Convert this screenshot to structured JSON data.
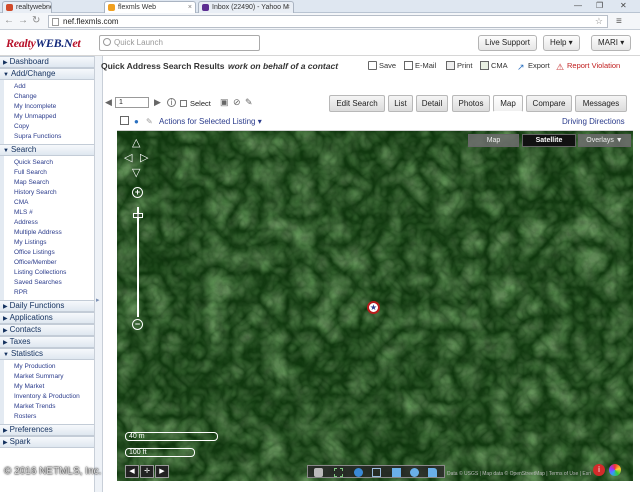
{
  "browser": {
    "tabs": [
      {
        "label": "realtywebnet",
        "color": "#d14a2a",
        "active": false
      },
      {
        "label": "flexmls Web",
        "color": "#f0a020",
        "active": true
      },
      {
        "label": "Inbox (22490) - Yahoo M",
        "color": "#5c2d91",
        "active": false
      }
    ],
    "url": "nef.flexmls.com"
  },
  "header": {
    "logo_a": "Realty",
    "logo_b": "WEB",
    "logo_c": ".N",
    "logo_d": "et",
    "quick_launch_placeholder": "Quick Launch",
    "live_support": "Live Support",
    "help": "Help",
    "user": "MARI"
  },
  "sidebar": {
    "sections": [
      {
        "title": "Dashboard",
        "items": []
      },
      {
        "title": "Add/Change",
        "items": [
          "Add",
          "Change",
          "My Incomplete",
          "My Unmapped",
          "Copy",
          "Supra Functions"
        ]
      },
      {
        "title": "Search",
        "items": [
          "Quick Search",
          "Full Search",
          "Map Search",
          "History Search",
          "CMA",
          "MLS #",
          "Address",
          "Multiple Address",
          "My Listings",
          "Office Listings",
          "Office/Member",
          "Listing Collections",
          "Saved Searches",
          "RPR"
        ]
      },
      {
        "title": "Daily Functions",
        "items": []
      },
      {
        "title": "Applications",
        "items": []
      },
      {
        "title": "Contacts",
        "items": []
      },
      {
        "title": "Taxes",
        "items": []
      },
      {
        "title": "Statistics",
        "items": [
          "My Production",
          "Market Summary",
          "My Market",
          "Inventory & Production",
          "Market Trends",
          "Rosters"
        ]
      },
      {
        "title": "Preferences",
        "items": []
      },
      {
        "title": "Spark",
        "items": []
      }
    ]
  },
  "page": {
    "title": "Quick Address Search Results",
    "subtitle": "work on behalf of a contact",
    "tools": [
      "Save",
      "E-Mail",
      "Print",
      "CMA",
      "Export",
      "Report Violation"
    ],
    "page_number": "1",
    "select_label": "Select",
    "view_tabs": [
      "Edit Search",
      "List",
      "Detail",
      "Photos",
      "Map",
      "Compare",
      "Messages"
    ],
    "active_view": "Map",
    "actions_label": "Actions for Selected Listing",
    "directions_label": "Driving Directions"
  },
  "map": {
    "types": [
      "Map",
      "Satellite",
      "Overlays ▼"
    ],
    "active_type": "Satellite",
    "zoom_level_fraction": 0.06,
    "scale_metric": "40 m",
    "scale_imperial": "100 ft",
    "attribution": "Data © USGS | Map data © OpenStreetMap | Terms of Use | Esri",
    "watermark": "© 2016 NETMLS, Inc."
  }
}
